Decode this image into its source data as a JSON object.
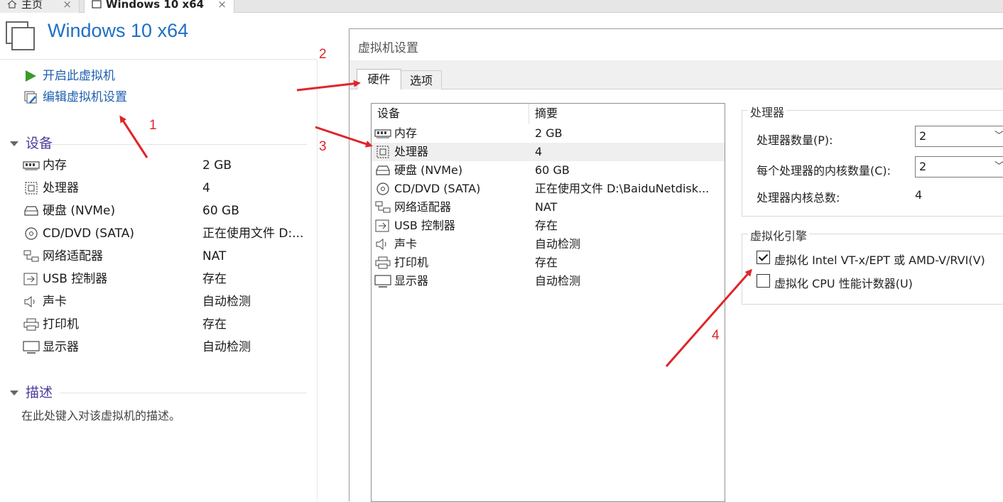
{
  "tabs": [
    {
      "label": "主页",
      "icon": "home-icon"
    },
    {
      "label": "Windows 10 x64",
      "icon": "vm-icon"
    }
  ],
  "vm": {
    "title": "Windows 10 x64",
    "actions": [
      {
        "label": "开启此虚拟机",
        "icon": "play-icon"
      },
      {
        "label": "编辑虚拟机设置",
        "icon": "edit-settings-icon"
      }
    ],
    "devices_heading": "设备",
    "devices": [
      {
        "name": "内存",
        "value": "2 GB",
        "icon": "memory-icon"
      },
      {
        "name": "处理器",
        "value": "4",
        "icon": "cpu-icon"
      },
      {
        "name": "硬盘 (NVMe)",
        "value": "60 GB",
        "icon": "disk-icon"
      },
      {
        "name": "CD/DVD (SATA)",
        "value": "正在使用文件 D:...",
        "icon": "cd-icon"
      },
      {
        "name": "网络适配器",
        "value": "NAT",
        "icon": "network-icon"
      },
      {
        "name": "USB 控制器",
        "value": "存在",
        "icon": "usb-icon"
      },
      {
        "name": "声卡",
        "value": "自动检测",
        "icon": "sound-icon"
      },
      {
        "name": "打印机",
        "value": "存在",
        "icon": "printer-icon"
      },
      {
        "name": "显示器",
        "value": "自动检测",
        "icon": "display-icon"
      }
    ],
    "description_heading": "描述",
    "description_placeholder": "在此处键入对该虚拟机的描述。"
  },
  "dialog": {
    "title": "虚拟机设置",
    "tabs": [
      "硬件",
      "选项"
    ],
    "list_headers": [
      "设备",
      "摘要"
    ],
    "devices": [
      {
        "name": "内存",
        "summary": "2 GB",
        "icon": "memory-icon"
      },
      {
        "name": "处理器",
        "summary": "4",
        "icon": "cpu-icon",
        "selected": true
      },
      {
        "name": "硬盘 (NVMe)",
        "summary": "60 GB",
        "icon": "disk-icon"
      },
      {
        "name": "CD/DVD (SATA)",
        "summary": "正在使用文件 D:\\BaiduNetdisk...",
        "icon": "cd-icon"
      },
      {
        "name": "网络适配器",
        "summary": "NAT",
        "icon": "network-icon"
      },
      {
        "name": "USB 控制器",
        "summary": "存在",
        "icon": "usb-icon"
      },
      {
        "name": "声卡",
        "summary": "自动检测",
        "icon": "sound-icon"
      },
      {
        "name": "打印机",
        "summary": "存在",
        "icon": "printer-icon"
      },
      {
        "name": "显示器",
        "summary": "自动检测",
        "icon": "display-icon"
      }
    ],
    "processor": {
      "group_title": "处理器",
      "count_label": "处理器数量(P):",
      "count_value": "2",
      "cores_label": "每个处理器的内核数量(C):",
      "cores_value": "2",
      "total_label": "处理器内核总数:",
      "total_value": "4"
    },
    "virtualization": {
      "group_title": "虚拟化引擎",
      "vtx_label": "虚拟化 Intel VT-x/EPT 或 AMD-V/RVI(V)",
      "vtx_checked": true,
      "perf_label": "虚拟化 CPU 性能计数器(U)",
      "perf_checked": false
    }
  },
  "annotations": [
    "1",
    "2",
    "3",
    "4"
  ],
  "colors": {
    "accent": "#1f6fc6",
    "annotation": "#e0242b",
    "section": "#4b3c9c"
  }
}
